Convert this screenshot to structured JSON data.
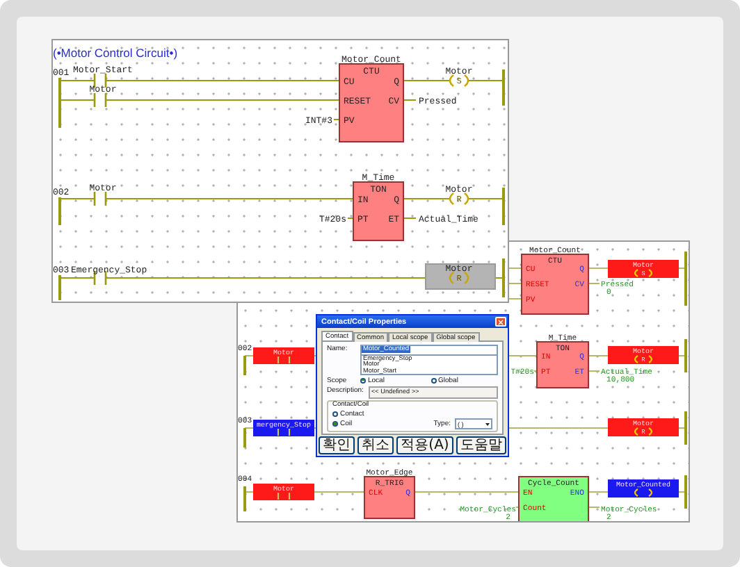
{
  "editor": {
    "title": "(•Motor Control Circuit•)",
    "items": [
      {
        "kind": "rung_number",
        "text": "001"
      },
      {
        "kind": "contact",
        "name": "Motor_Start"
      },
      {
        "kind": "contact",
        "name": "Motor"
      },
      {
        "kind": "block",
        "instance": "Motor_Count",
        "type": "CTU",
        "inputs": [
          "CU",
          "RESET",
          "PV"
        ],
        "outputs": [
          "Q",
          "CV"
        ],
        "color": "#ff8080"
      },
      {
        "kind": "variable",
        "text": "INT#3"
      },
      {
        "kind": "coil",
        "name": "Motor",
        "symbol": "S",
        "selected": false
      },
      {
        "kind": "variable",
        "text": "Pressed"
      },
      {
        "kind": "rung_number",
        "text": "002"
      },
      {
        "kind": "contact",
        "name": "Motor"
      },
      {
        "kind": "block",
        "instance": "M_Time",
        "type": "TON",
        "inputs": [
          "IN",
          "PT"
        ],
        "outputs": [
          "Q",
          "ET"
        ],
        "color": "#ff8080"
      },
      {
        "kind": "variable",
        "text": "T#20s"
      },
      {
        "kind": "coil",
        "name": "Motor",
        "symbol": "R",
        "selected": false
      },
      {
        "kind": "variable",
        "text": "Actual_Time"
      },
      {
        "kind": "rung_number",
        "text": "003"
      },
      {
        "kind": "contact",
        "name": "Emergency_Stop"
      },
      {
        "kind": "coil",
        "name": "Motor",
        "symbol": "R",
        "selected": true
      }
    ]
  },
  "monitor": {
    "items": [
      {
        "kind": "block",
        "instance": "Motor_Count",
        "type": "CTU",
        "inputs": [
          "CU",
          "RESET",
          "PV"
        ],
        "outputs": [
          "Q",
          "CV"
        ],
        "color": "#ff8080"
      },
      {
        "kind": "coil",
        "name": "Motor",
        "symbol": "S",
        "energized": true
      },
      {
        "kind": "variable",
        "text": "Pressed",
        "value": "0"
      },
      {
        "kind": "rung_number",
        "text": "002"
      },
      {
        "kind": "contact",
        "name": "Motor",
        "energized": true
      },
      {
        "kind": "block",
        "instance": "M_Time",
        "type": "TON",
        "inputs": [
          "IN",
          "PT"
        ],
        "outputs": [
          "Q",
          "ET"
        ],
        "color": "#ff8080"
      },
      {
        "kind": "variable",
        "text": "T#20s"
      },
      {
        "kind": "coil",
        "name": "Motor",
        "symbol": "R",
        "energized": true
      },
      {
        "kind": "variable",
        "text": "Actual_Time",
        "value": "10,800"
      },
      {
        "kind": "rung_number",
        "text": "003"
      },
      {
        "kind": "contact",
        "name": "mergency_Stop",
        "energized": false
      },
      {
        "kind": "coil",
        "name": "Motor",
        "symbol": "R",
        "energized": true
      },
      {
        "kind": "rung_number",
        "text": "004"
      },
      {
        "kind": "contact",
        "name": "Motor",
        "energized": true
      },
      {
        "kind": "block",
        "instance": "Motor_Edge",
        "type": "R_TRIG",
        "inputs": [
          "CLK"
        ],
        "outputs": [
          "Q"
        ],
        "color": "#ff8080"
      },
      {
        "kind": "variable",
        "text": "Motor_Cycles",
        "value": "2"
      },
      {
        "kind": "block",
        "instance": "Cycle_Count",
        "inputs": [
          "EN",
          "Count"
        ],
        "outputs": [
          "ENO"
        ],
        "color": "#80ff80"
      },
      {
        "kind": "coil",
        "name": "Motor_Counted",
        "energized": false
      },
      {
        "kind": "variable",
        "text": "Motor_Cycles",
        "value": "2"
      }
    ]
  },
  "dialog": {
    "title": "Contact/Coil Properties",
    "tabs": [
      {
        "label": "Contact",
        "selected": true
      },
      {
        "label": "Common",
        "selected": false
      },
      {
        "label": "Local scope",
        "selected": false
      },
      {
        "label": "Global scope",
        "selected": false
      }
    ],
    "name_label": "Name:",
    "name_value": "Motor_Counted",
    "name_options": [
      "Emergency_Stop",
      "Motor",
      "Motor_Start"
    ],
    "scope_label": "Scope",
    "scopes": [
      {
        "label": "Local",
        "selected": true
      },
      {
        "label": "Global",
        "selected": false
      }
    ],
    "description_label": "Description:",
    "description": "<< Undefined >>",
    "group_label": "Contact/Coil",
    "element_types": [
      {
        "label": "Contact",
        "selected": false
      },
      {
        "label": "Coil",
        "selected": true
      }
    ],
    "type_label": "Type:",
    "type_value": "( )",
    "buttons": [
      "확인",
      "취소",
      "적용(A)",
      "도움말"
    ]
  }
}
